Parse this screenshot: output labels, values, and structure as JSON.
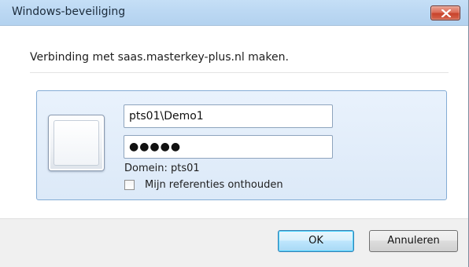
{
  "window": {
    "title": "Windows-beveiliging"
  },
  "dialog": {
    "prompt": "Verbinding met saas.masterkey-plus.nl maken.",
    "username": "pts01\\Demo1",
    "password_mask": "●●●●●",
    "domain_text": "Domein: pts01",
    "remember_label": "Mijn referenties onthouden",
    "remember_checked": false
  },
  "buttons": {
    "ok_label": "OK",
    "cancel_label": "Annuleren"
  },
  "colors": {
    "titlebar": "#bcd8f3",
    "close_button": "#c8432b",
    "credential_panel": "#dce9f8",
    "footer": "#f0f0f0"
  },
  "icons": {
    "close": "close-icon",
    "user_tile": "user-tile-icon"
  }
}
